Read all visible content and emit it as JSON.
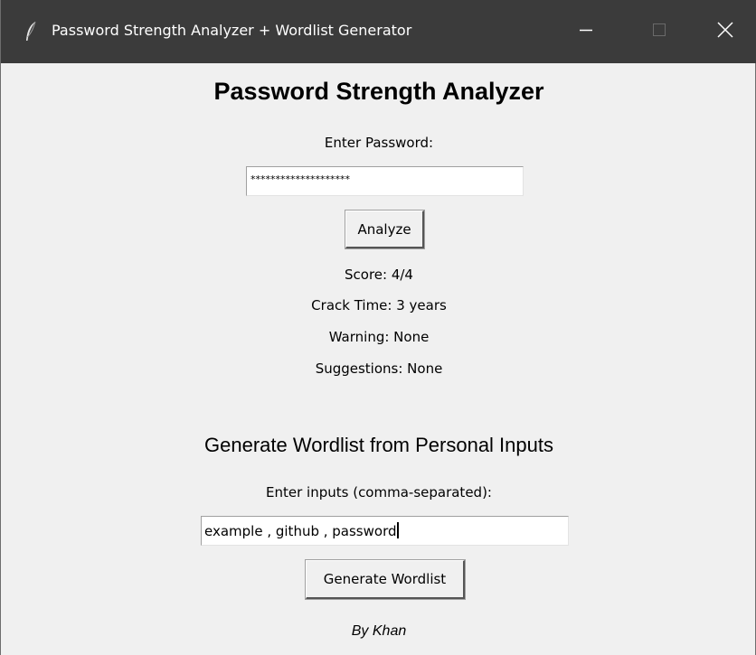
{
  "window": {
    "title": "Password Strength Analyzer + Wordlist Generator",
    "icon": "feather-icon",
    "controls": {
      "minimize": "minimize-icon",
      "maximize": "maximize-icon",
      "close": "close-icon"
    },
    "titlebar_color": "#3b3b3b",
    "background_color": "#f0f0f0"
  },
  "analyzer": {
    "heading": "Password Strength Analyzer",
    "password_label": "Enter Password:",
    "password_value": "********************",
    "analyze_button": "Analyze",
    "score": "Score: 4/4",
    "crack_time": "Crack Time: 3 years",
    "warning": "Warning: None",
    "suggestions": "Suggestions: None"
  },
  "wordlist": {
    "heading": "Generate Wordlist from Personal Inputs",
    "inputs_label": "Enter inputs (comma-separated):",
    "inputs_value": "example , github , password",
    "generate_button": "Generate Wordlist"
  },
  "footer": {
    "credit": "By Khan"
  }
}
